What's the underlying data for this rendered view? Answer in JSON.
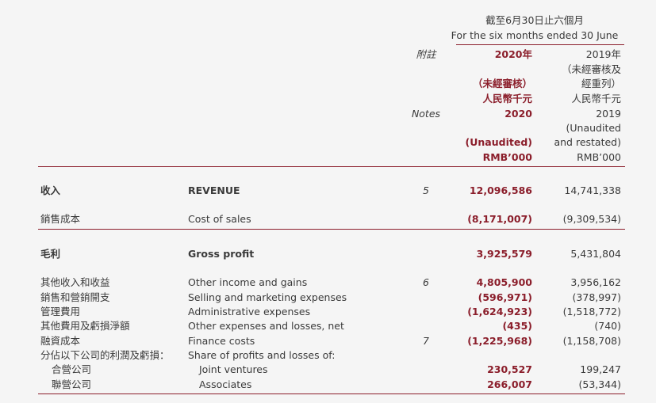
{
  "header": {
    "period_zh": "截至6月30日止六個月",
    "period_en": "For the six months ended 30 June",
    "notes_zh": "附註",
    "notes_en": "Notes",
    "col2020": {
      "year_zh": "2020年",
      "unaudited_zh": "（未經審核）",
      "currency_zh": "人民幣千元",
      "year_en": "2020",
      "unaudited_en": "(Unaudited)",
      "currency_en": "RMB’000"
    },
    "col2019": {
      "year_zh": "2019年",
      "line1_zh": "（未經審核及",
      "line2_zh": "經重列）",
      "currency_zh": "人民幣千元",
      "year_en": "2019",
      "line1_en": "(Unaudited",
      "line2_en": "and restated)",
      "currency_en": "RMB’000"
    }
  },
  "rows": {
    "revenue": {
      "zh": "收入",
      "en": "REVENUE",
      "note": "5",
      "v2020": "12,096,586",
      "v2019": "14,741,338"
    },
    "cost_of_sales": {
      "zh": "銷售成本",
      "en": "Cost of sales",
      "note": "",
      "v2020": "(8,171,007)",
      "v2019": "(9,309,534)"
    },
    "gross_profit": {
      "zh": "毛利",
      "en": "Gross profit",
      "note": "",
      "v2020": "3,925,579",
      "v2019": "5,431,804"
    },
    "other_income": {
      "zh": "其他收入和收益",
      "en": "Other income and gains",
      "note": "6",
      "v2020": "4,805,900",
      "v2019": "3,956,162"
    },
    "selling": {
      "zh": "銷售和營銷開支",
      "en": "Selling and marketing expenses",
      "note": "",
      "v2020": "(596,971)",
      "v2019": "(378,997)"
    },
    "admin": {
      "zh": "管理費用",
      "en": "Administrative expenses",
      "note": "",
      "v2020": "(1,624,923)",
      "v2019": "(1,518,772)"
    },
    "other_exp": {
      "zh": "其他費用及虧損淨額",
      "en": "Other expenses and losses, net",
      "note": "",
      "v2020": "(435)",
      "v2019": "(740)"
    },
    "finance": {
      "zh": "融資成本",
      "en": "Finance costs",
      "note": "7",
      "v2020": "(1,225,968)",
      "v2019": "(1,158,708)"
    },
    "share": {
      "zh": "分佔以下公司的利潤及虧損：",
      "en": "Share of profits and losses of:",
      "note": "",
      "v2020": "",
      "v2019": ""
    },
    "jv": {
      "zh": "合營公司",
      "en": "Joint ventures",
      "note": "",
      "v2020": "230,527",
      "v2019": "199,247"
    },
    "assoc": {
      "zh": "聯營公司",
      "en": "Associates",
      "note": "",
      "v2020": "266,007",
      "v2019": "(53,344)"
    }
  }
}
